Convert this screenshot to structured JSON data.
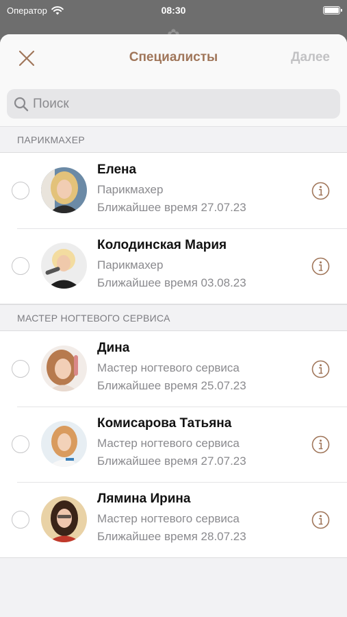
{
  "status_bar": {
    "carrier": "Оператор",
    "time": "08:30",
    "icons": [
      "wifi-icon",
      "battery-icon"
    ]
  },
  "header": {
    "title": "Специалисты",
    "close_icon": "close-icon",
    "next_label": "Далее"
  },
  "search": {
    "placeholder": "Поиск",
    "value": "",
    "icon": "search-icon"
  },
  "colors": {
    "accent": "#a0765a",
    "disabled": "#c2c2c4",
    "secondary_text": "#8a8a8e"
  },
  "sections": [
    {
      "title": "ПАРИКМАХЕР",
      "items": [
        {
          "name": "Елена",
          "role": "Парикмахер",
          "next_time": "Ближайшее время 27.07.23",
          "selected": false
        },
        {
          "name": "Колодинская Мария",
          "role": "Парикмахер",
          "next_time": "Ближайшее время 03.08.23",
          "selected": false
        }
      ]
    },
    {
      "title": "МАСТЕР НОГТЕВОГО СЕРВИСА",
      "items": [
        {
          "name": "Дина",
          "role": "Мастер ногтевого сервиса",
          "next_time": "Ближайшее время 25.07.23",
          "selected": false
        },
        {
          "name": "Комисарова Татьяна",
          "role": "Мастер ногтевого сервиса",
          "next_time": "Ближайшее время 27.07.23",
          "selected": false
        },
        {
          "name": "Лямина Ирина",
          "role": "Мастер ногтевого сервиса",
          "next_time": "Ближайшее время 28.07.23",
          "selected": false
        }
      ]
    }
  ]
}
